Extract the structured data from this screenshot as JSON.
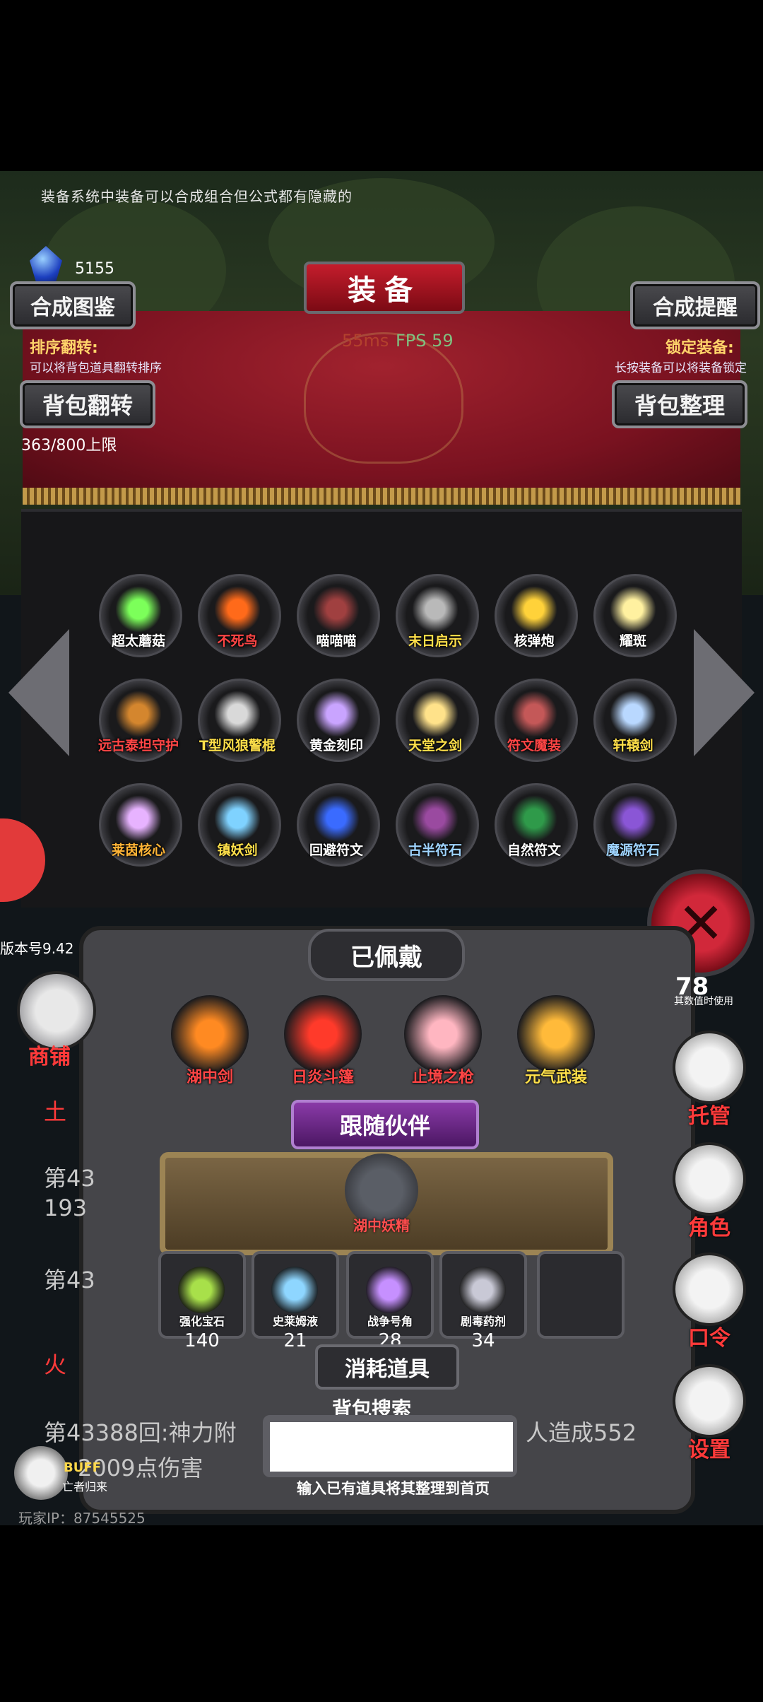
{
  "hint": "装备系统中装备可以合成组合但公式都有隐藏的",
  "gems": "5155",
  "header": {
    "title": "装备",
    "left_button": "合成图鉴",
    "right_button": "合成提醒",
    "sort_label": "排序翻转:",
    "sort_desc": "可以将背包道具翻转排序",
    "lock_label": "锁定装备:",
    "lock_desc": "长按装备可以将装备锁定",
    "flip_button": "背包翻转",
    "tidy_button": "背包整理",
    "capacity": "363/800上限",
    "ping": "55ms",
    "fps": "FPS 59"
  },
  "inventory": [
    {
      "name": "超太蘑菇",
      "color": "#7cff5a",
      "cls": "white"
    },
    {
      "name": "不死鸟",
      "color": "#ff6a1a",
      "cls": "red"
    },
    {
      "name": "喵喵喵",
      "color": "#a04040",
      "cls": "white"
    },
    {
      "name": "末日启示",
      "color": "#b9b9b9",
      "cls": "yellow"
    },
    {
      "name": "核弹炮",
      "color": "#ffd23a",
      "cls": "white"
    },
    {
      "name": "耀斑",
      "color": "#fff1a0",
      "cls": "white"
    },
    {
      "name": "远古泰坦守护",
      "color": "#d4862e",
      "cls": "red"
    },
    {
      "name": "T型风狼警棍",
      "color": "#d9d9d9",
      "cls": "yellow"
    },
    {
      "name": "黄金刻印",
      "color": "#c9a4ff",
      "cls": "white"
    },
    {
      "name": "天堂之剑",
      "color": "#ffe28a",
      "cls": "yellow"
    },
    {
      "name": "符文魔装",
      "color": "#c45858",
      "cls": "red"
    },
    {
      "name": "轩辕剑",
      "color": "#b9d8ff",
      "cls": "yellow"
    },
    {
      "name": "莱茵核心",
      "color": "#e7b3ff",
      "cls": "gold"
    },
    {
      "name": "镇妖剑",
      "color": "#7fd2ff",
      "cls": "yellow"
    },
    {
      "name": "回避符文",
      "color": "#3a6bff",
      "cls": "white"
    },
    {
      "name": "古半符石",
      "color": "#9a4aa0",
      "cls": "blue"
    },
    {
      "name": "自然符文",
      "color": "#2f9a4a",
      "cls": "white"
    },
    {
      "name": "魔源符石",
      "color": "#8a56d6",
      "cls": "blue"
    }
  ],
  "equipped": {
    "tab": "已佩戴",
    "items": [
      {
        "name": "湖中剑",
        "color": "#ff8a22"
      },
      {
        "name": "日炎斗篷",
        "color": "#ff3a2a"
      },
      {
        "name": "止境之枪",
        "color": "#ffb6c1"
      },
      {
        "name": "元气武装",
        "color": "#ffba3a"
      }
    ]
  },
  "companion": {
    "banner": "跟随伙伴",
    "name": "湖中妖精"
  },
  "consumables": {
    "tab": "消耗道具",
    "items": [
      {
        "name": "强化宝石",
        "count": "140",
        "color": "#a8e04a"
      },
      {
        "name": "史莱姆液",
        "count": "21",
        "color": "#8ed6ff"
      },
      {
        "name": "战争号角",
        "count": "28",
        "color": "#c690ff"
      },
      {
        "name": "剧毒药剂",
        "count": "34",
        "color": "#c9c9d6"
      }
    ]
  },
  "search": {
    "title": "背包搜索",
    "placeholder": "",
    "hint": "输入已有道具将其整理到首页"
  },
  "left": {
    "version": "版本号9.42",
    "shop": "商铺",
    "buff": "BUFF",
    "buff_sub": "亡者归来",
    "player_ip": "玩家IP：87545525",
    "log": {
      "l1": "土",
      "l2": "第43",
      "l3": "193",
      "l4": "第43",
      "l5": "火",
      "l6": "第43388回:神力附",
      "l7": "人造成552",
      "l8": "2009点伤害"
    }
  },
  "right": {
    "stat_note": "其数值时使用",
    "stat_top": "78",
    "manage": "托管",
    "role": "角色",
    "code": "口令",
    "settings": "设置"
  }
}
